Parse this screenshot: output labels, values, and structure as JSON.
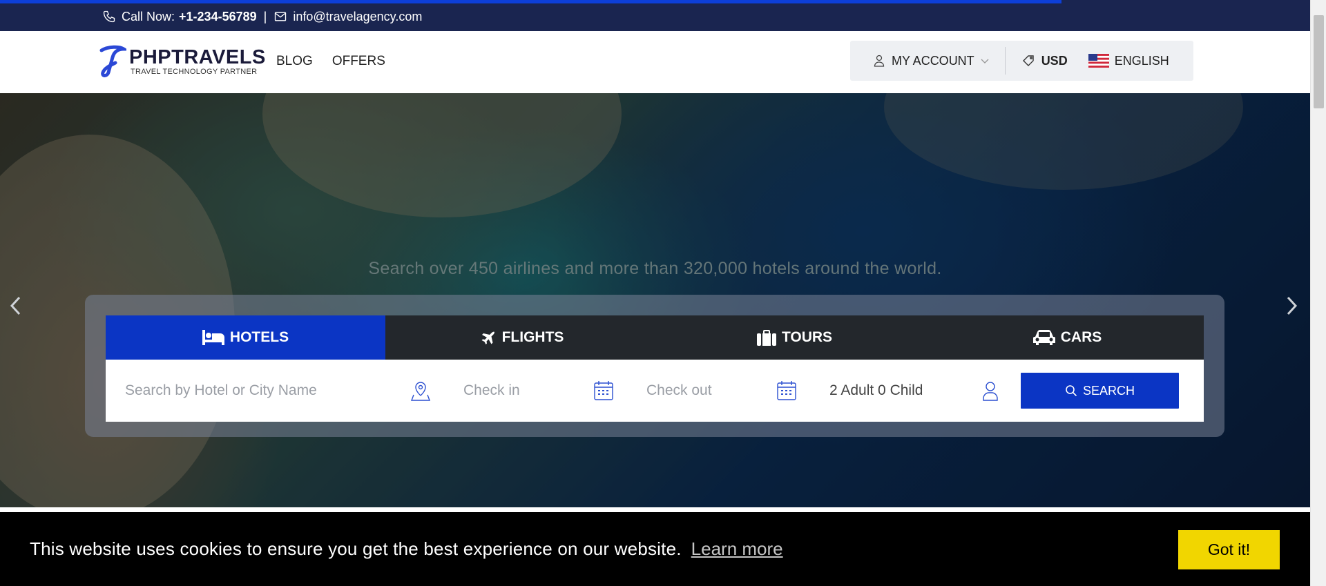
{
  "topbar": {
    "call_label": "Call Now:",
    "phone": "+1-234-56789",
    "separator": "|",
    "email": "info@travelagency.com",
    "progress_percent": 81
  },
  "header": {
    "logo_name": "PHPTRAVELS",
    "logo_tagline": "TRAVEL TECHNOLOGY PARTNER",
    "nav": [
      "BLOG",
      "OFFERS"
    ],
    "my_account": "MY ACCOUNT",
    "currency": "USD",
    "language": "ENGLISH"
  },
  "hero": {
    "subtitle": "Search over 450 airlines and more than 320,000 hotels around the world."
  },
  "search": {
    "tabs": [
      {
        "label": "HOTELS",
        "icon": "bed-icon",
        "active": true
      },
      {
        "label": "FLIGHTS",
        "icon": "plane-icon",
        "active": false
      },
      {
        "label": "TOURS",
        "icon": "suitcase-icon",
        "active": false
      },
      {
        "label": "CARS",
        "icon": "car-icon",
        "active": false
      }
    ],
    "city_placeholder": "Search by Hotel or City Name",
    "checkin": "Check in",
    "checkout": "Check out",
    "guests": "2 Adult 0 Child",
    "button": "SEARCH"
  },
  "cookie": {
    "message": "This website uses cookies to ensure you get the best experience on our website.",
    "learn_more": "Learn more",
    "accept": "Got it!"
  },
  "colors": {
    "primary": "#0b35c4",
    "topbar": "#1a2550",
    "cookie_button": "#f1d600"
  }
}
